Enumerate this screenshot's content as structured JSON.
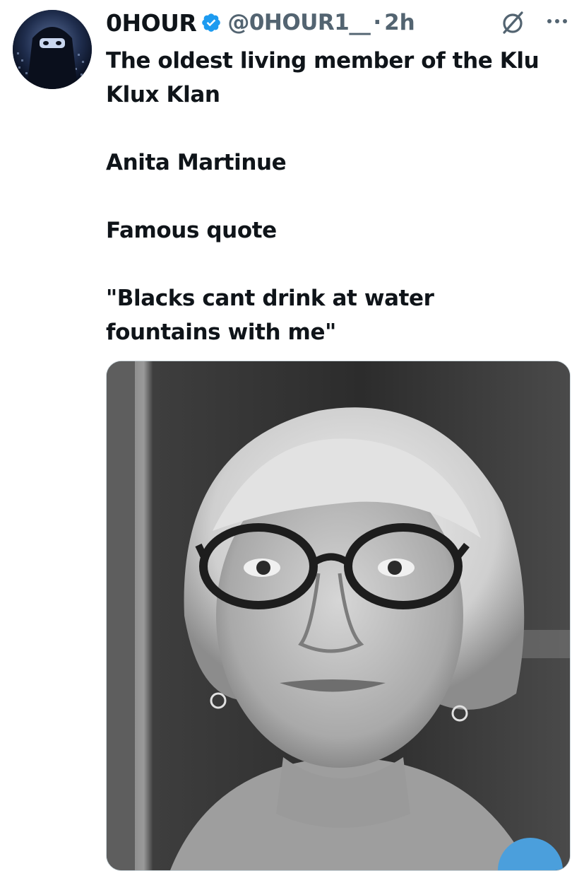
{
  "tweet": {
    "author": {
      "display_name": "0HOUR",
      "handle": "@0HOUR1__",
      "verified": true,
      "avatar_icon": "hooded-figure-avatar"
    },
    "separator": "·",
    "time": "2h",
    "lines": [
      "The oldest living member of the Klu",
      "Klux Klan",
      "",
      "Anita Martinue",
      "",
      "Famous quote",
      "",
      "\"Blacks cant drink at water",
      "fountains with me\""
    ],
    "media": {
      "type": "photo",
      "style": "black-and-white portrait"
    }
  },
  "icons": {
    "verified": "verified-badge-icon",
    "grok": "grok-icon",
    "more": "more-options-icon"
  },
  "colors": {
    "text": "#0f1419",
    "secondary": "#536471",
    "verified": "#1d9bf0"
  }
}
